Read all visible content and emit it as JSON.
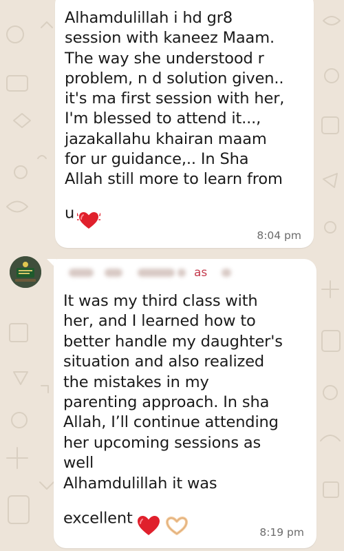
{
  "colors": {
    "wallpaper": "#ede4d9",
    "bubble": "#ffffff",
    "text": "#1a1a1a",
    "time": "#6b6b6b",
    "sender": "#c43a4d",
    "heart": "#e0202c"
  },
  "messages": [
    {
      "text": "Alhamdulillah i hd gr8\nsession with kaneez Maam.\nThe way she understood r\nproblem, n d solution given..\nit's ma first session with her,\nI'm blessed to attend it...,\njazakallahu khairan maam\nfor ur guidance,.. In Sha\nAllah still more to learn from\nu",
      "emoji": [
        "sparkling-heart-icon"
      ],
      "time": "8:04 pm"
    },
    {
      "sender_partial": "as",
      "text": "It was my third class with\nher, and I learned how to\nbetter handle my daughter's\nsituation and also realized\nthe mistakes in my\nparenting approach. In sha\nAllah, I’ll continue attending\nher upcoming sessions as\nwell\nAlhamdulillah it was\nexcellent",
      "emoji": [
        "red-heart-icon",
        "heart-hands-icon"
      ],
      "time": "8:19 pm"
    }
  ]
}
